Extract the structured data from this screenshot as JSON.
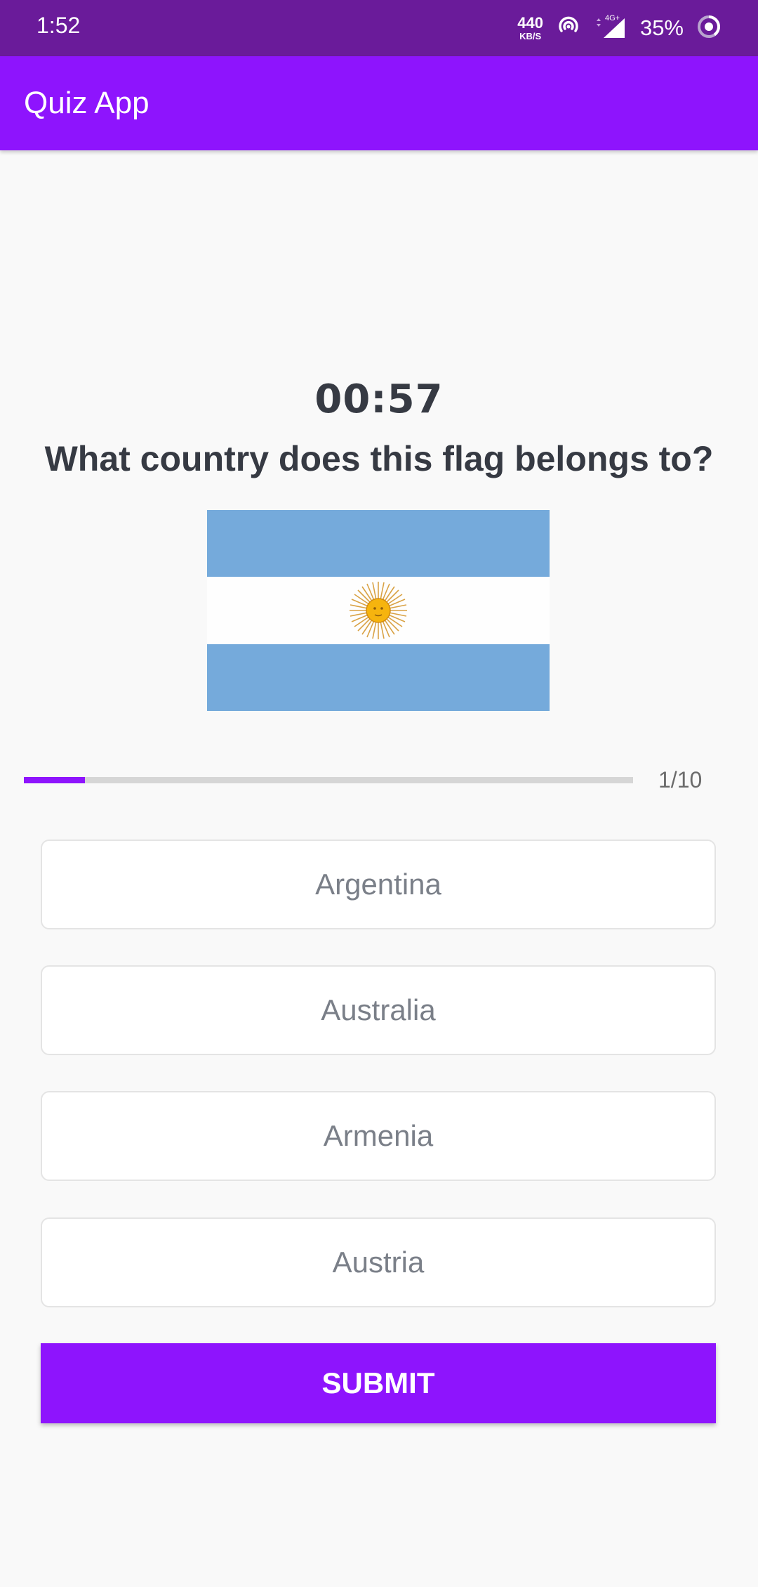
{
  "status_bar": {
    "time": "1:52",
    "net_speed": "440",
    "net_speed_unit": "KB/S",
    "network_type": "4G+",
    "battery": "35%"
  },
  "app_bar": {
    "title": "Quiz App"
  },
  "quiz": {
    "timer": "00:57",
    "question": "What country does this flag belongs to?",
    "flag_icon": "argentina-flag",
    "progress_label": "1/10",
    "progress_fraction": 0.1,
    "options": [
      {
        "label": "Argentina"
      },
      {
        "label": "Australia"
      },
      {
        "label": "Armenia"
      },
      {
        "label": "Austria"
      }
    ],
    "submit_label": "SUBMIT"
  },
  "colors": {
    "status_bar": "#6a1b9a",
    "accent": "#8e14fd",
    "text_dark": "#363a43",
    "option_text": "#7a7f88",
    "flag_blue": "#75aadb"
  }
}
